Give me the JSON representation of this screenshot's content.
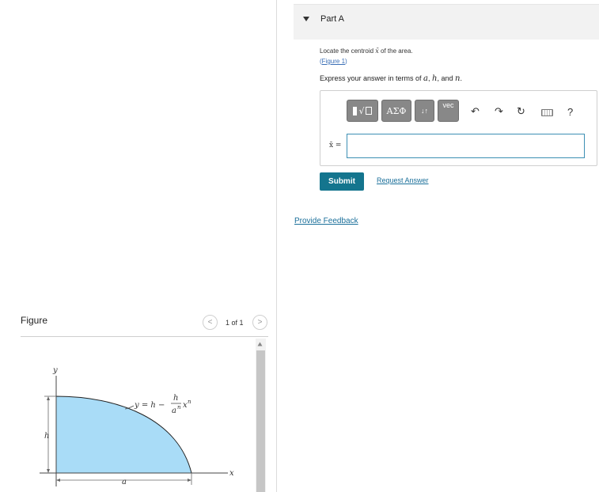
{
  "part": {
    "title": "Part A"
  },
  "question": {
    "prompt_text": "Locate the centroid ",
    "prompt_symbol": "x̄",
    "prompt_suffix": " of the area.",
    "figure_link": "Figure 1",
    "express_prefix": "Express your answer in terms of ",
    "var_a": "a",
    "var_h": "h",
    "var_n": "n",
    "sep1": ", ",
    "sep2": ", and ",
    "end": "."
  },
  "toolbar": {
    "greek_label": "ΑΣΦ",
    "arrows_label": "↓↑",
    "vec_label": "vec",
    "undo_icon": "↶",
    "redo_icon": "↷",
    "reset_icon": "↻",
    "help_label": "?"
  },
  "answer": {
    "label": "x̄ =",
    "value": ""
  },
  "actions": {
    "submit_label": "Submit",
    "request_label": "Request Answer",
    "feedback_label": "Provide Feedback"
  },
  "figure": {
    "title": "Figure",
    "pager": "1 of 1",
    "prev_icon": "<",
    "next_icon": ">",
    "labels": {
      "y_axis": "y",
      "x_axis": "x",
      "h_dim": "h",
      "a_dim": "a",
      "curve_lhs": "y = h −",
      "curve_num": "h",
      "curve_den": "a",
      "curve_den_exp": "n",
      "curve_var": "x",
      "curve_var_exp": "n"
    },
    "fill_color": "#a9dcf7"
  },
  "colors": {
    "submit_bg": "#14758e",
    "link": "#1a6f9a",
    "input_border": "#3c8fb4"
  }
}
